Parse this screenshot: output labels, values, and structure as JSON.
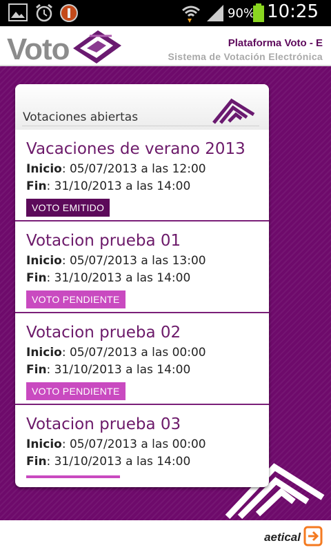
{
  "status_bar": {
    "battery_percent": "90%",
    "time": "10:25"
  },
  "header": {
    "logo_text": "Voto",
    "title": "Plataforma Voto - E",
    "subtitle": "Sistema de Votación Electrónica"
  },
  "card": {
    "title": "Votaciones abiertas",
    "start_label": "Inicio",
    "end_label": "Fin",
    "items": [
      {
        "title": "Vacaciones de verano 2013",
        "start": ": 05/07/2013 a las 12:00",
        "end": ": 31/10/2013 a las 14:00",
        "status": "VOTO EMITIDO"
      },
      {
        "title": "Votacion prueba 01",
        "start": ": 05/07/2013 a las 13:00",
        "end": ": 31/10/2013 a las 14:00",
        "status": "VOTO PENDIENTE"
      },
      {
        "title": "Votacion prueba 02",
        "start": ": 05/07/2013 a las 00:00",
        "end": ": 31/10/2013 a las 14:00",
        "status": "VOTO PENDIENTE"
      },
      {
        "title": "Votacion prueba 03",
        "start": ": 05/07/2013 a las 00:00",
        "end": ": 31/10/2013 a las 14:00"
      }
    ]
  },
  "footer": {
    "brand": "aetical"
  },
  "colors": {
    "brand_purple": "#6e0a6b",
    "emitido": "#5c0a5a",
    "pendiente": "#c94ac0",
    "footer_accent": "#f47a20"
  }
}
